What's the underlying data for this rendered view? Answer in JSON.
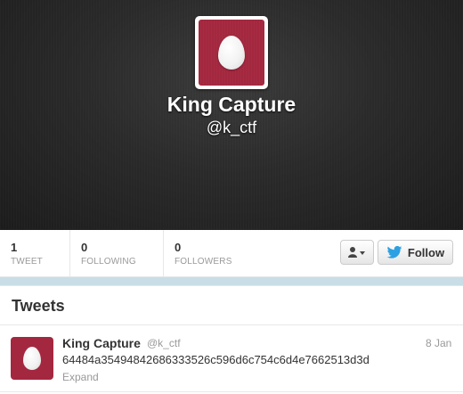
{
  "profile": {
    "name": "King Capture",
    "handle": "@k_ctf"
  },
  "stats": [
    {
      "value": "1",
      "label": "TWEET"
    },
    {
      "value": "0",
      "label": "FOLLOWING"
    },
    {
      "value": "0",
      "label": "FOLLOWERS"
    }
  ],
  "actions": {
    "follow_label": "Follow",
    "user_menu_icon": "person-icon",
    "twitter_icon": "twitter-bird-icon"
  },
  "tweets_section": {
    "title": "Tweets",
    "items": [
      {
        "name": "King Capture",
        "handle": "@k_ctf",
        "date": "8 Jan",
        "text": "64484a35494842686333526c596d6c754c6d4e7662513d3d",
        "expand_label": "Expand"
      }
    ]
  },
  "colors": {
    "avatar_bg": "#a3283f",
    "twitter_blue": "#2ba0e3",
    "header_bg": "#2a2a2a"
  }
}
